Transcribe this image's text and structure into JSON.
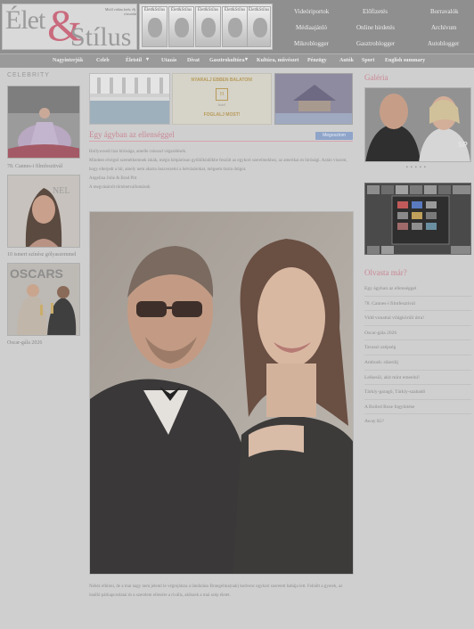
{
  "logo": {
    "part1": "Élet",
    "amp": "&",
    "part2": "Stílus",
    "slogan": "Mitől vidám kedv, élj a rózsaidat!"
  },
  "magazines": [
    {
      "title": "Élet&Stílus"
    },
    {
      "title": "Élet&Stílus"
    },
    {
      "title": "Élet&Stílus"
    },
    {
      "title": "Élet&Stílus"
    },
    {
      "title": "Élet&Stílus"
    }
  ],
  "top_links": {
    "row1": [
      "Videóriportok",
      "Előfizetés",
      "Borravalók"
    ],
    "row2": [
      "Médiaajánló",
      "Online hirdetés",
      "Archívum"
    ],
    "row3": [
      "Mikroblogger",
      "Gasztroblogger",
      "Autoblogger"
    ]
  },
  "nav": [
    "Nagyinterjúk",
    "Celeb",
    "Életstíl",
    "Utazás",
    "Divat",
    "Gasztrokultúra",
    "Kultúra, művészet",
    "Pénzügy",
    "Autók",
    "Sport",
    "English summary"
  ],
  "left": {
    "section_title": "CELEBRITY",
    "items": [
      {
        "caption": "78. Cannes-i filmfesztivál"
      },
      {
        "caption": "10 ismert színész gólyaszemmel"
      },
      {
        "caption": "Oscar-gála 2026"
      }
    ]
  },
  "banners": {
    "center_top": "NYARALJ EBBEN BALATON!",
    "center_logo": "H",
    "center_name": "hotel",
    "center_bottom": "FOGLALJ MOST!"
  },
  "article": {
    "title": "Egy ágyban az ellenséggel",
    "share": "Megosztom",
    "lead1": "Hollywoodi liza bírósága, amelle csisszal végszélésék.",
    "lead2": "Mindent elvégső szemétkemnek iskák, mégis hétpárósan gyűlölködőkbe feszült az egykori szerelmekhez, az amerikai és bírósági. Aztán viszont, hogy elterjedt a hír, amely nem akarta összvezetni a hétvásárokat, mégsem tiszta dolgot.",
    "lead3": "Angelina Jolie & Brad Pitt",
    "lead4": "A megvásárolt történetvallomások",
    "body": "Nehéz elhinni, de a mai nagy nem jelenti le végrejátsza a lánduláso Brangelina(nak) kedvenc egykori szeretett babája lett. Felnőtt a gyerek, az önálló párkapcsolatai és a szerelem ellenére a rivális, akiknek a mai szép életet."
  },
  "right": {
    "gallery_title": "Galéria",
    "dots": "• • • • •",
    "read_title": "Olvasta már?",
    "read_items": [
      "Egy ágyban az ellenséggel",
      "78. Cannes-i filmfesztivál",
      "Vidd vonattal világkörüli útra!",
      "Oscar-gála 2026",
      "Tavaszi szépség",
      "Ambush: sikerülj",
      "Lelkesül, akit mint emeelni!",
      "Tárkíy-garagő, Tárkíy-szabadő",
      "A Boiled Rose fogyhitése",
      "Away Ki?"
    ]
  },
  "colors": {
    "header_bg": "#8f8f8f",
    "accent_pink": "#c98896",
    "share_blue": "#8fa4c9"
  }
}
